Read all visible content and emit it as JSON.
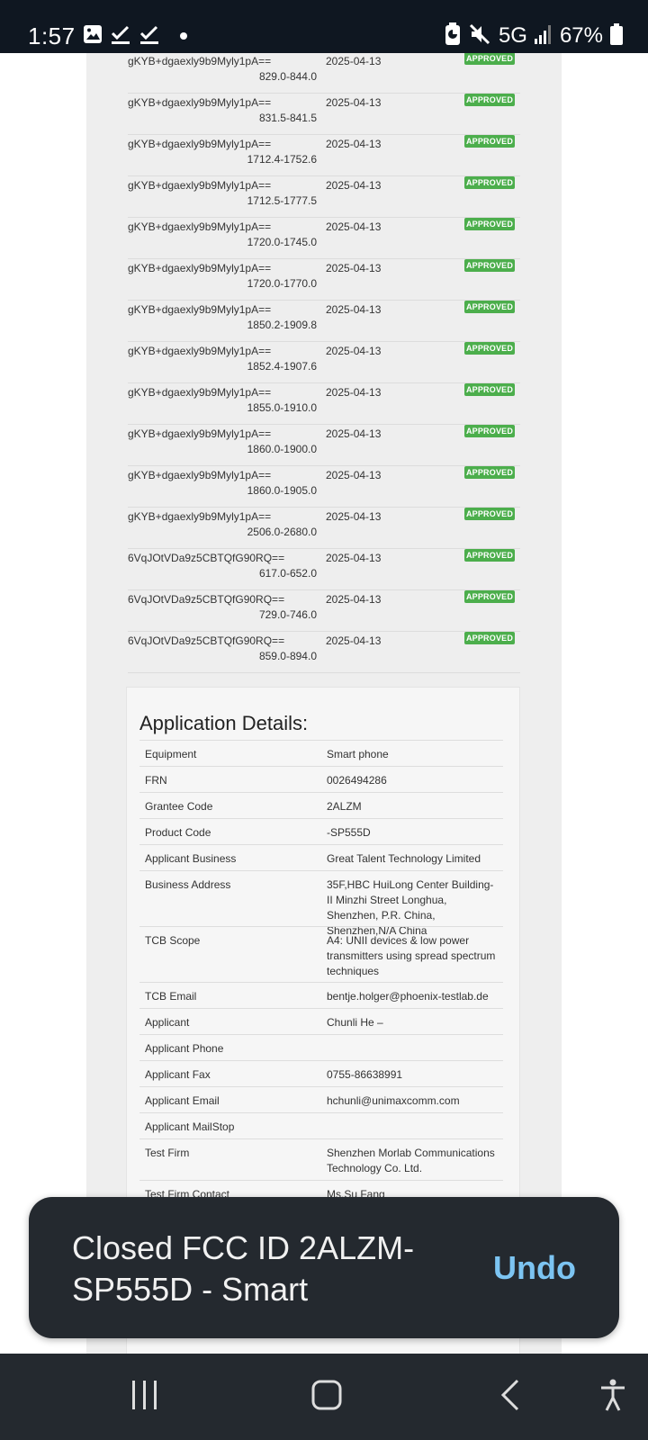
{
  "status_bar": {
    "time": "1:57",
    "network": "5G",
    "battery": "67%",
    "icons": [
      "image-icon",
      "check-icon",
      "check-icon",
      "dot-icon",
      "battery-saver-icon",
      "mute-icon",
      "signal-icon",
      "battery-icon"
    ]
  },
  "grants": [
    {
      "id": "gKYB+dgaexly9b9Myly1pA==",
      "range": "829.0-844.0",
      "date": "2025-04-13",
      "status": "APPROVED"
    },
    {
      "id": "gKYB+dgaexly9b9Myly1pA==",
      "range": "831.5-841.5",
      "date": "2025-04-13",
      "status": "APPROVED"
    },
    {
      "id": "gKYB+dgaexly9b9Myly1pA==",
      "range": "1712.4-1752.6",
      "date": "2025-04-13",
      "status": "APPROVED"
    },
    {
      "id": "gKYB+dgaexly9b9Myly1pA==",
      "range": "1712.5-1777.5",
      "date": "2025-04-13",
      "status": "APPROVED"
    },
    {
      "id": "gKYB+dgaexly9b9Myly1pA==",
      "range": "1720.0-1745.0",
      "date": "2025-04-13",
      "status": "APPROVED"
    },
    {
      "id": "gKYB+dgaexly9b9Myly1pA==",
      "range": "1720.0-1770.0",
      "date": "2025-04-13",
      "status": "APPROVED"
    },
    {
      "id": "gKYB+dgaexly9b9Myly1pA==",
      "range": "1850.2-1909.8",
      "date": "2025-04-13",
      "status": "APPROVED"
    },
    {
      "id": "gKYB+dgaexly9b9Myly1pA==",
      "range": "1852.4-1907.6",
      "date": "2025-04-13",
      "status": "APPROVED"
    },
    {
      "id": "gKYB+dgaexly9b9Myly1pA==",
      "range": "1855.0-1910.0",
      "date": "2025-04-13",
      "status": "APPROVED"
    },
    {
      "id": "gKYB+dgaexly9b9Myly1pA==",
      "range": "1860.0-1900.0",
      "date": "2025-04-13",
      "status": "APPROVED"
    },
    {
      "id": "gKYB+dgaexly9b9Myly1pA==",
      "range": "1860.0-1905.0",
      "date": "2025-04-13",
      "status": "APPROVED"
    },
    {
      "id": "gKYB+dgaexly9b9Myly1pA==",
      "range": "2506.0-2680.0",
      "date": "2025-04-13",
      "status": "APPROVED"
    },
    {
      "id": "6VqJOtVDa9z5CBTQfG90RQ==",
      "range": "617.0-652.0",
      "date": "2025-04-13",
      "status": "APPROVED"
    },
    {
      "id": "6VqJOtVDa9z5CBTQfG90RQ==",
      "range": "729.0-746.0",
      "date": "2025-04-13",
      "status": "APPROVED"
    },
    {
      "id": "6VqJOtVDa9z5CBTQfG90RQ==",
      "range": "859.0-894.0",
      "date": "2025-04-13",
      "status": "APPROVED"
    }
  ],
  "details": {
    "title": "Application Details:",
    "rows": [
      {
        "label": "Equipment",
        "value": "Smart phone"
      },
      {
        "label": "FRN",
        "value": "0026494286"
      },
      {
        "label": "Grantee Code",
        "value": "2ALZM"
      },
      {
        "label": "Product Code",
        "value": "-SP555D"
      },
      {
        "label": "Applicant Business",
        "value": "Great Talent Technology Limited"
      },
      {
        "label": "Business Address",
        "value": "35F,HBC HuiLong Center Building-II Minzhi Street Longhua, Shenzhen, P.R. China, Shenzhen,N/A China"
      },
      {
        "label": "TCB Scope",
        "value": "A4: UNII devices & low power transmitters using spread spectrum techniques"
      },
      {
        "label": "TCB Email",
        "value": "bentje.holger@phoenix-testlab.de"
      },
      {
        "label": "Applicant",
        "value": "Chunli He –"
      },
      {
        "label": "Applicant Phone",
        "value": ""
      },
      {
        "label": "Applicant Fax",
        "value": "0755-86638991"
      },
      {
        "label": "Applicant Email",
        "value": "hchunli@unimaxcomm.com"
      },
      {
        "label": "Applicant MailStop",
        "value": ""
      },
      {
        "label": "Test Firm",
        "value": "Shenzhen Morlab Communications Technology Co. Ltd."
      },
      {
        "label": "Test Firm Contact",
        "value": "Ms.Su Fang"
      }
    ]
  },
  "snackbar": {
    "message": "Closed FCC ID 2ALZM-SP555D - Smart",
    "action": "Undo"
  },
  "nav": {
    "buttons": [
      "recent-apps",
      "home",
      "back",
      "accessibility"
    ]
  }
}
